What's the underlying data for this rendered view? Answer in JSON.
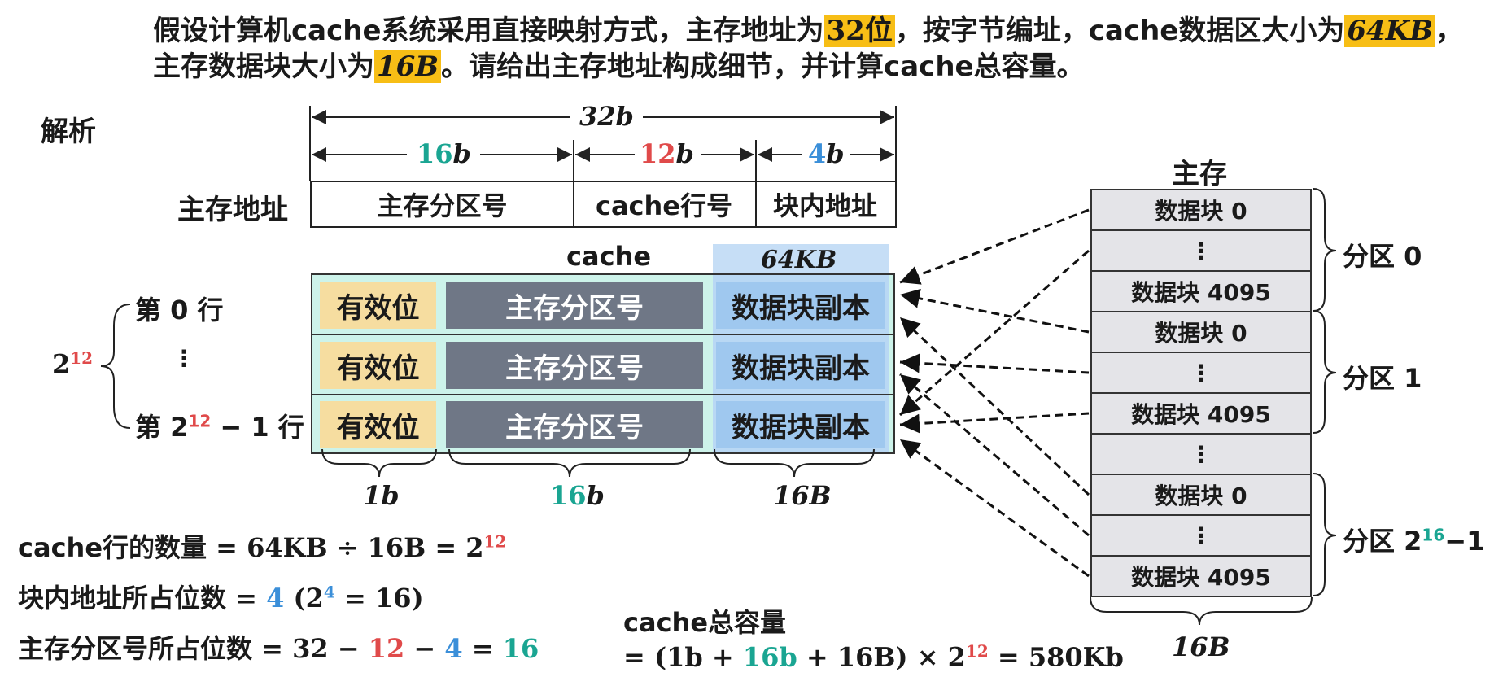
{
  "question": {
    "line1_a": "假设计算机cache系统采用直接映射方式，主存地址为",
    "line1_hl1": "32位",
    "line1_b": "，按字节编址，cache数据区大小为",
    "line1_hl2": "64KB",
    "line1_c": "，",
    "line2_a": "主存数据块大小为",
    "line2_hl": "16B",
    "line2_b": "。请给出主存地址构成细节，并计算cache总容量。"
  },
  "analysis_label": "解析",
  "address": {
    "total": "32b",
    "row_label": "主存地址",
    "fields": [
      {
        "width_num": "16",
        "width_unit": "b",
        "name": "主存分区号"
      },
      {
        "width_num": "12",
        "width_unit": "b",
        "name": "cache行号"
      },
      {
        "width_num": "4",
        "width_unit": "b",
        "name": "块内地址"
      }
    ]
  },
  "cache": {
    "title": "cache",
    "data_size": "64KB",
    "rows": [
      {
        "valid": "有效位",
        "tag": "主存分区号",
        "data": "数据块副本"
      },
      {
        "valid": "有效位",
        "tag": "主存分区号",
        "data": "数据块副本"
      },
      {
        "valid": "有效位",
        "tag": "主存分区号",
        "data": "数据块副本"
      }
    ],
    "row_first": "第 0 行",
    "row_dots": "⋮",
    "row_last_a": "第 2",
    "row_last_exp": "12",
    "row_last_b": " − 1 行",
    "count_base": "2",
    "count_exp": "12",
    "widths": {
      "valid": "1b",
      "tag_num": "16",
      "tag_unit": "b",
      "data": "16B"
    }
  },
  "memory": {
    "title": "主存",
    "block_first": "数据块 0",
    "block_dots": "⋮",
    "block_last": "数据块 4095",
    "partitions": [
      "分区 0",
      "分区 1"
    ],
    "last_partition_a": "分区 2",
    "last_partition_exp": "16",
    "last_partition_b": "−1",
    "width": "16B"
  },
  "formulas": {
    "f1_label": "cache行的数量",
    "f1_expr": " = 64KB ÷ 16B = 2",
    "f1_exp": "12",
    "f2_label": "块内地址所占位数",
    "f2_a": " = ",
    "f2_val": "4",
    "f2_b": " (2",
    "f2_exp": "4",
    "f2_c": " = 16)",
    "f3_label": "主存分区号所占位数",
    "f3_a": " = 32 − ",
    "f3_b": "12",
    "f3_c": " − ",
    "f3_d": "4",
    "f3_e": " = ",
    "f3_f": "16",
    "total_label": "cache总容量",
    "total_a": "= (1b + ",
    "total_b": "16b",
    "total_c": " + 16B) × 2",
    "total_exp": "12",
    "total_d": " = 580Kb"
  },
  "colors": {
    "highlight": "#f7be16",
    "teal": "#1aa592",
    "red": "#e04a4a",
    "blue": "#3b8fd9",
    "valid_bg": "#f6dda0",
    "tag_bg": "#6f7786",
    "data_bg": "#9fc8ef",
    "cache_bg": "#cdf3ea",
    "mem_bg": "#e4e4e8"
  }
}
